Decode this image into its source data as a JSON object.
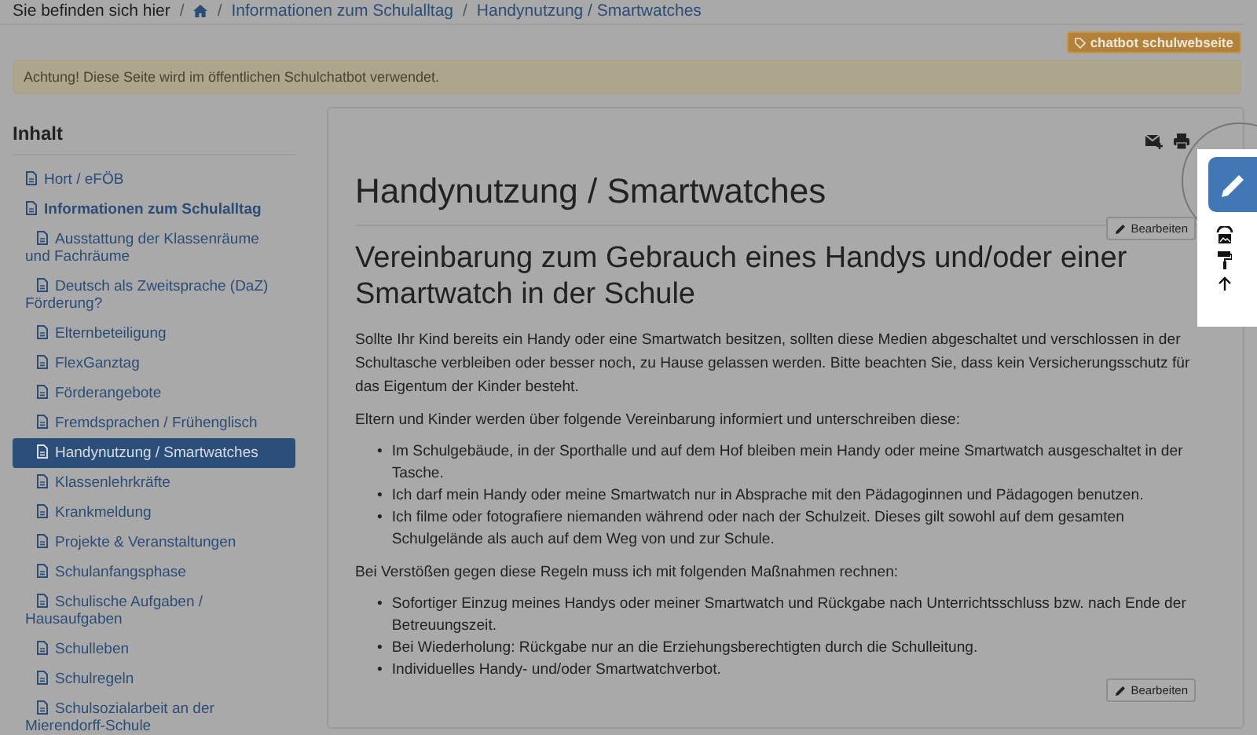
{
  "breadcrumb": {
    "label": "Sie befinden sich hier",
    "separator": "/",
    "links": [
      "Informationen zum Schulalltag",
      "Handynutzung / Smartwatches"
    ]
  },
  "tag_button": "chatbot schulwebseite",
  "alert": "Achtung! Diese Seite wird im öffentlichen Schulchatbot verwendet.",
  "sidebar": {
    "title": "Inhalt",
    "items": [
      {
        "label": "Hort / eFÖB",
        "selected": false,
        "expanded": false
      },
      {
        "label": "Informationen zum Schulalltag",
        "selected": false,
        "expanded": true,
        "children": [
          {
            "label": "Ausstattung der Klassenräume und Fachräume",
            "selected": false
          },
          {
            "label": "Deutsch als Zweitsprache (DaZ) Förderung?",
            "selected": false
          },
          {
            "label": "Elternbeteiligung",
            "selected": false
          },
          {
            "label": "FlexGanztag",
            "selected": false
          },
          {
            "label": "Förderangebote",
            "selected": false
          },
          {
            "label": "Fremdsprachen / Frühenglisch",
            "selected": false
          },
          {
            "label": "Handynutzung / Smartwatches",
            "selected": true
          },
          {
            "label": "Klassenlehrkräfte",
            "selected": false
          },
          {
            "label": "Krankmeldung",
            "selected": false
          },
          {
            "label": "Projekte & Veranstaltungen",
            "selected": false
          },
          {
            "label": "Schulanfangsphase",
            "selected": false
          },
          {
            "label": "Schulische Aufgaben / Hausaufgaben",
            "selected": false
          },
          {
            "label": "Schulleben",
            "selected": false
          },
          {
            "label": "Schulregeln",
            "selected": false
          },
          {
            "label": "Schulsozialarbeit an der Mierendorff-Schule",
            "selected": false
          }
        ]
      }
    ]
  },
  "article": {
    "blocks": [
      {
        "kind": "h1",
        "text": "Handynutzung / Smartwatches"
      },
      {
        "kind": "edit",
        "text": "Bearbeiten"
      },
      {
        "kind": "h2",
        "text": "Vereinbarung zum Gebrauch eines Handys und/oder einer Smartwatch in der Schule"
      },
      {
        "kind": "paragraph",
        "text": "Sollte Ihr Kind bereits ein Handy oder eine Smartwatch besitzen, sollten diese Medien abgeschaltet und verschlossen in der Schultasche verbleiben oder besser noch, zu Hause gelassen werden. Bitte beachten Sie, dass kein Versicherungsschutz für das Eigentum der Kinder besteht."
      },
      {
        "kind": "paragraph",
        "text": "Eltern und Kinder werden über folgende Vereinbarung informiert und unterschreiben diese:"
      },
      {
        "kind": "list",
        "bullet": "•",
        "items": [
          "Im Schulgebäude, in der Sporthalle und auf dem Hof bleiben mein Handy oder meine Smartwatch ausgeschaltet in der Tasche.",
          "Ich darf mein Handy oder meine Smartwatch nur in Absprache mit den Pädagoginnen und Pädagogen benutzen.",
          "Ich filme oder fotografiere niemanden während oder nach der Schulzeit. Dieses gilt sowohl auf dem gesamten Schulgelände als auch auf dem Weg von und zur Schule."
        ]
      },
      {
        "kind": "paragraph",
        "text": "Bei Verstößen gegen diese Regeln muss ich mit folgenden Maßnahmen rechnen:"
      },
      {
        "kind": "list",
        "bullet": "•",
        "items": [
          "Sofortiger Einzug meines Handys oder meiner Smartwatch und Rückgabe nach Unterrichtsschluss bzw. nach Ende der Betreuungszeit.",
          "Bei Wiederholung: Rückgabe nur an die Erziehungsberechtigten durch die Schulleitung.",
          "Individuelles Handy- und/oder Smartwatchverbot."
        ]
      },
      {
        "kind": "edit",
        "text": "Bearbeiten"
      }
    ]
  }
}
